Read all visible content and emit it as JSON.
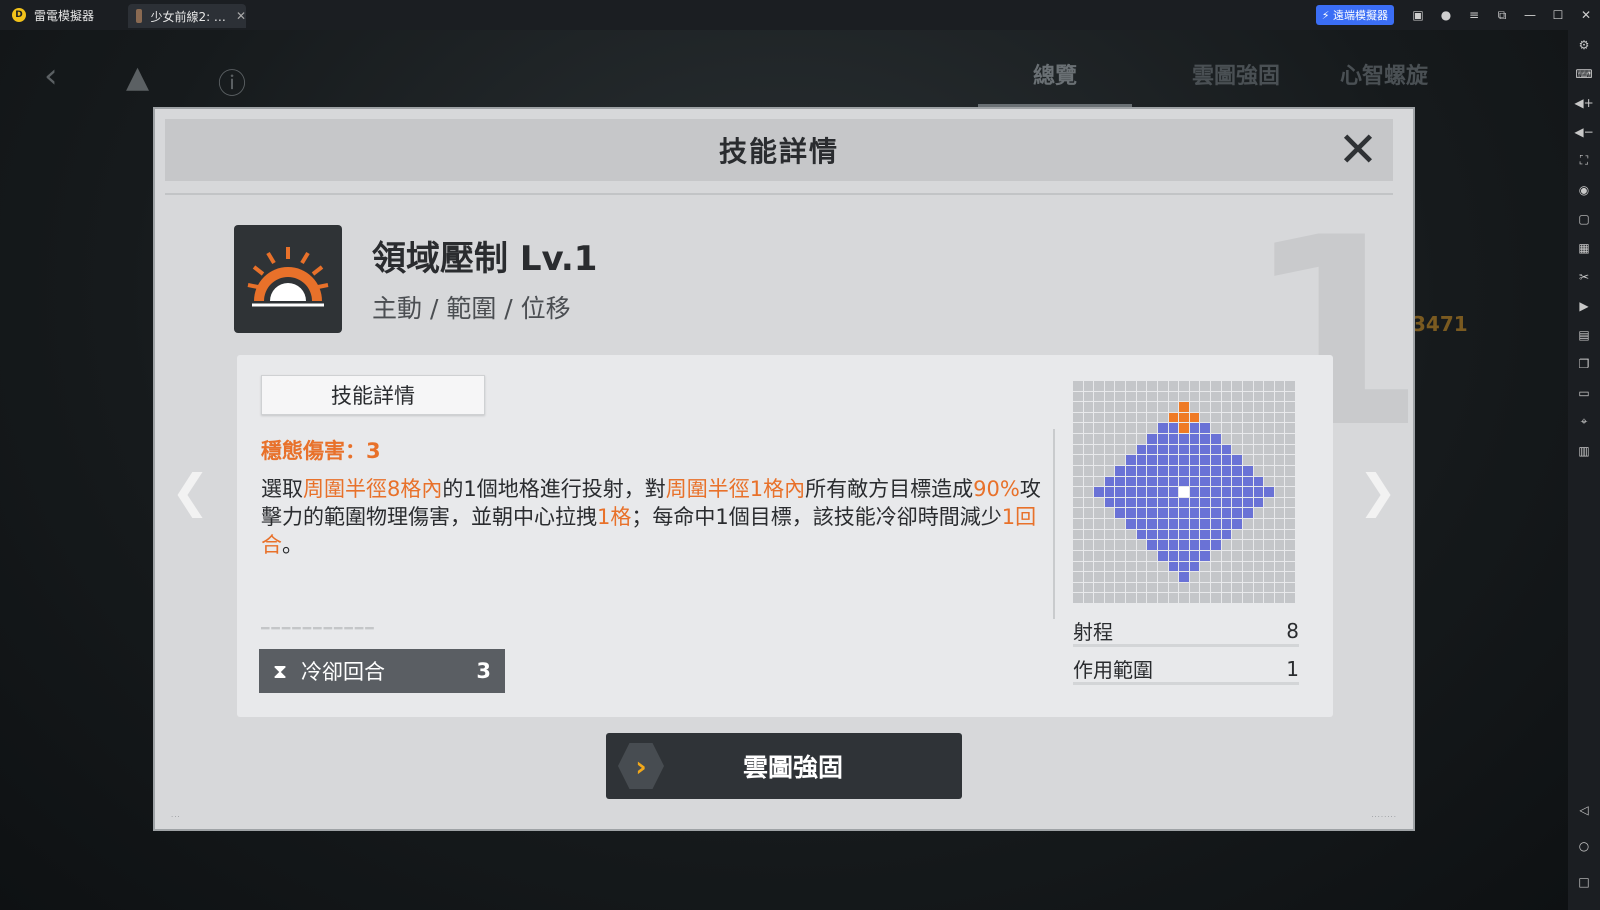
{
  "titlebar": {
    "app_name": "雷電模擬器",
    "tab_title": "少女前線2: …",
    "tab_close": "✕",
    "sync_button": "⚡ 遠端模擬器"
  },
  "game": {
    "top_tabs": [
      "總覽",
      "雲圖強固",
      "心智螺旋"
    ],
    "bg_number": "3471"
  },
  "modal": {
    "title": "技能詳情",
    "close": "✕",
    "bg_level_digit": "1",
    "skill": {
      "name": "領域壓制 Lv.1",
      "tags": "主動 / 範圍 / 位移"
    },
    "detail_tab": "技能詳情",
    "stagger": "穩態傷害：3",
    "description": [
      {
        "t": "選取",
        "h": false
      },
      {
        "t": "周圍半徑8格內",
        "h": true
      },
      {
        "t": "的1個地格進行投射，對",
        "h": false
      },
      {
        "t": "周圍半徑1格內",
        "h": true
      },
      {
        "t": "所有敵方目標造成",
        "h": false
      },
      {
        "t": "90%",
        "h": true
      },
      {
        "t": "攻擊力的範圍物理傷害，並朝中心拉拽",
        "h": false
      },
      {
        "t": "1格",
        "h": true
      },
      {
        "t": "；每命中1個目標，該技能冷卻時間減少",
        "h": false
      },
      {
        "t": "1回合",
        "h": true
      },
      {
        "t": "。",
        "h": false
      }
    ],
    "cooldown": {
      "label": "冷卻回合",
      "value": "3"
    },
    "stats": [
      {
        "label": "射程",
        "value": "8"
      },
      {
        "label": "作用範圍",
        "value": "1"
      }
    ],
    "range_grid": {
      "size": 21,
      "range": 8,
      "area": 1
    },
    "enhance_button": "雲圖強固"
  },
  "colors": {
    "accent_orange": "#e8712a",
    "grid_blue": "#6a72d6",
    "grid_gray": "#c4c6c9"
  }
}
